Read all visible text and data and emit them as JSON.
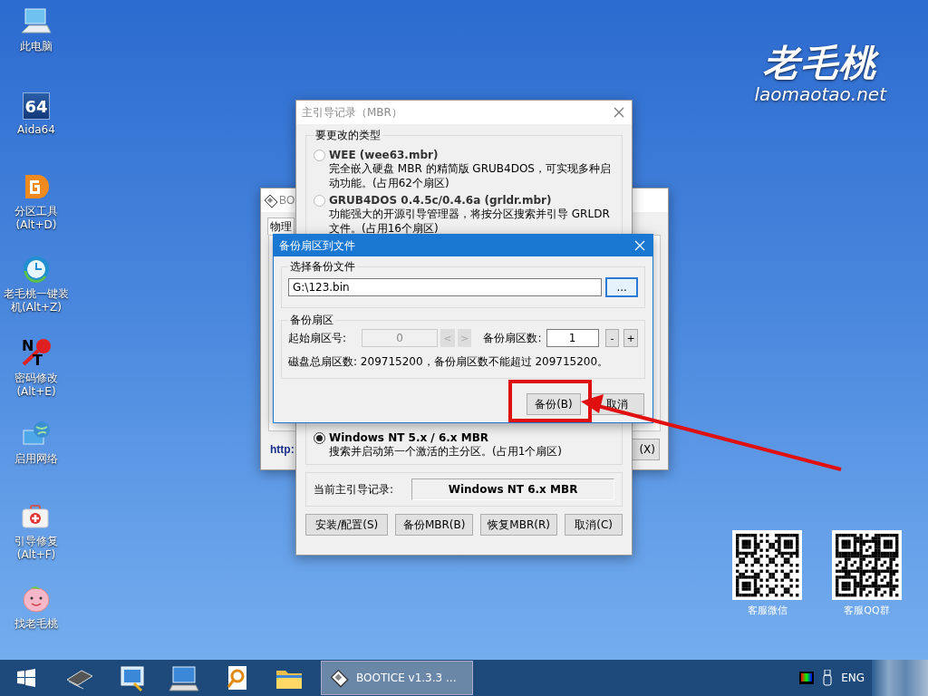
{
  "desktop_icons": [
    {
      "kind": "computer",
      "label": "此电脑"
    },
    {
      "kind": "aida",
      "label": "Aida64",
      "tile_text": "64"
    },
    {
      "kind": "partition",
      "label": "分区工具\n(Alt+D)"
    },
    {
      "kind": "installer",
      "label": "老毛桃一键装机(Alt+Z)"
    },
    {
      "kind": "key",
      "label": "密码修改\n(Alt+E)",
      "letters": [
        "N",
        "T"
      ]
    },
    {
      "kind": "network",
      "label": "启用网络"
    },
    {
      "kind": "firstaid",
      "label": "引导修复\n(Alt+F)"
    },
    {
      "kind": "peach",
      "label": "找老毛桃"
    }
  ],
  "logo": {
    "mark": "老毛桃",
    "site": "laomaotao.net"
  },
  "bootice_window": {
    "title": "BO",
    "active": false,
    "tab": "物理",
    "link": "http:",
    "button": "(X)"
  },
  "mbr_window": {
    "title": "主引导记录（MBR）",
    "active": false,
    "group": "要更改的类型",
    "options": [
      {
        "label": "WEE (wee63.mbr)",
        "description": "完全嵌入硬盘 MBR 的精简版 GRUB4DOS，可实现多种启动功能。(占用62个扇区)",
        "selected": false
      },
      {
        "label": "GRUB4DOS 0.4.5c/0.4.6a (grldr.mbr)",
        "description": "功能强大的开源引导管理器，将按分区搜索并引导 GRLDR 文件。(占用16个扇区)",
        "selected": false
      },
      {
        "label": "Windows NT 5.x / 6.x MBR",
        "description": "搜索并启动第一个激活的主分区。(占用1个扇区)",
        "selected": true
      }
    ],
    "current_label": "当前主引导记录:",
    "current_value": "Windows NT 6.x MBR",
    "buttons": [
      "安装/配置(S)",
      "备份MBR(B)",
      "恢复MBR(R)",
      "取消(C)"
    ]
  },
  "backup_dialog": {
    "title": "备份扇区到文件",
    "active": true,
    "file_group": "选择备份文件",
    "file_path": "G:\\123.bin",
    "browse_button": "...",
    "sector_group": "备份扇区",
    "start_label": "起始扇区号:",
    "start_value": "0",
    "start_disabled": true,
    "prev_button": "<",
    "next_button": ">",
    "count_label": "备份扇区数:",
    "count_value": "1",
    "minus_button": "-",
    "plus_button": "+",
    "info": "磁盘总扇区数: 209715200，备份扇区数不能超过 209715200。",
    "buttons": [
      "备份(B)",
      "取消"
    ]
  },
  "taskbar": {
    "apps": [
      {
        "kind": "chip"
      },
      {
        "kind": "control"
      },
      {
        "kind": "keyboard"
      },
      {
        "kind": "search"
      },
      {
        "kind": "folder"
      }
    ],
    "task": "BOOTICE v1.3.3 ...",
    "language": "ENG"
  },
  "qr_codes": [
    {
      "caption": "客服微信"
    },
    {
      "caption": "客服QQ群"
    }
  ]
}
